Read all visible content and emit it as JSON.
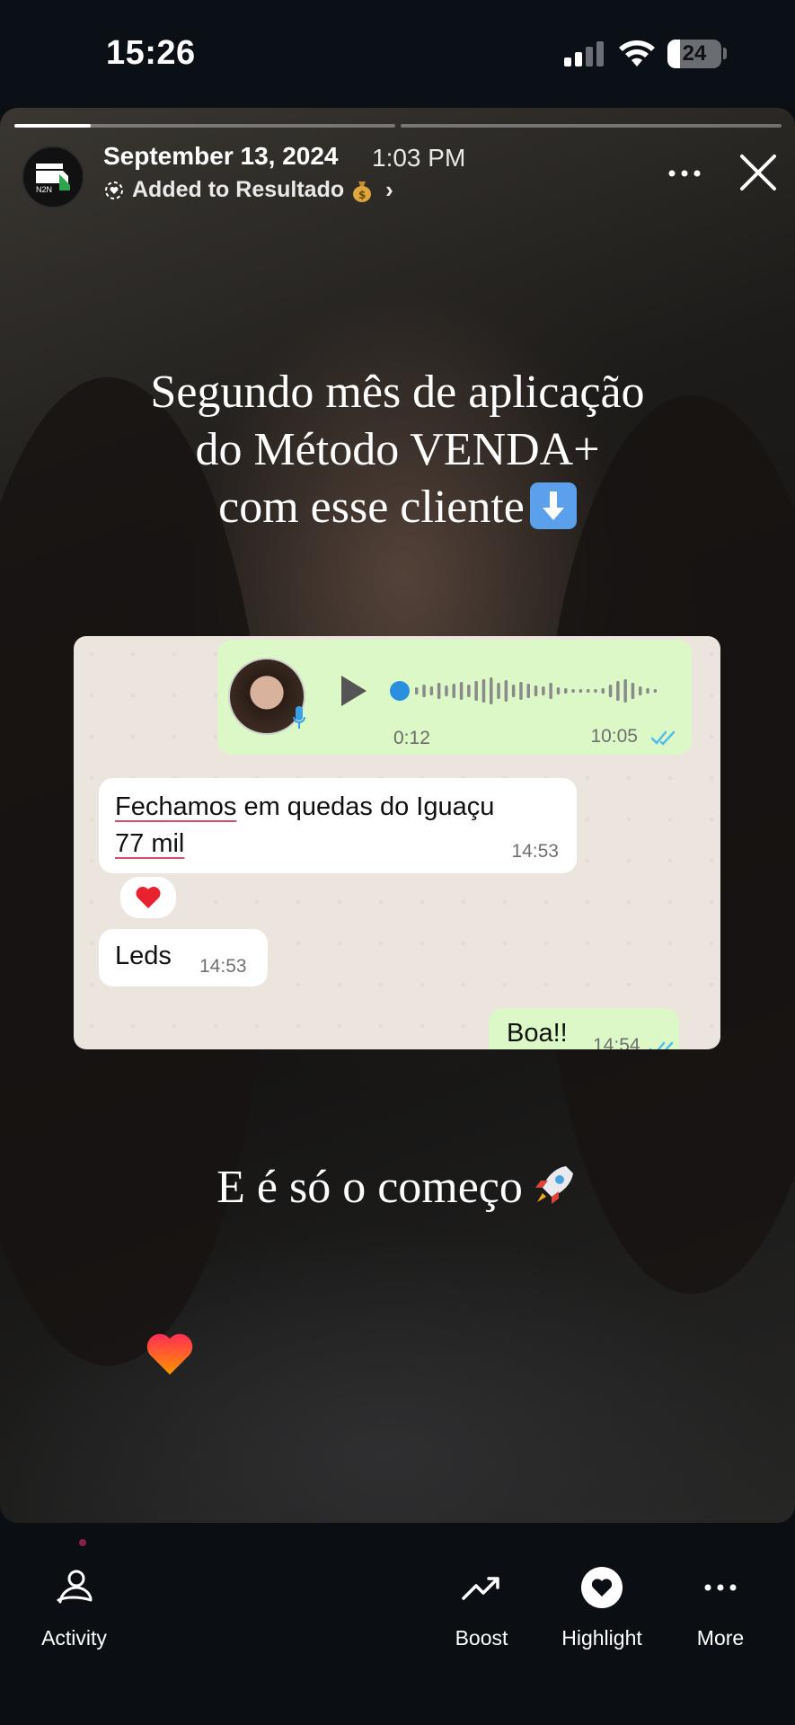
{
  "status_bar": {
    "time": "15:26",
    "battery": "24",
    "battery_level": 0.24
  },
  "story": {
    "progress_segments": 2,
    "active_segment_progress": 0.2,
    "date": "September 13, 2024",
    "time": "1:03 PM",
    "added_to": "Added to Resultado",
    "headline_lines": [
      "Segundo mês de aplicação",
      "do Método VENDA+",
      "com esse cliente"
    ],
    "tagline": "E é só o começo"
  },
  "chat": {
    "voice": {
      "duration": "0:12",
      "time": "10:05"
    },
    "messages": [
      {
        "line1_underlined": "Fechamos",
        "line1_rest": " em quedas do Iguaçu",
        "line2": "77 mil",
        "time": "14:53",
        "reaction": "heart"
      },
      {
        "text": "Leds",
        "time": "14:53"
      },
      {
        "text": "Boa!!",
        "time": "14:54"
      }
    ]
  },
  "bottom_nav": {
    "activity": "Activity",
    "boost": "Boost",
    "highlight": "Highlight",
    "more": "More"
  },
  "colors": {
    "accent_blue": "#53bdeb",
    "bubble_out": "#dcf8c6",
    "heart": "#ff3b30"
  }
}
